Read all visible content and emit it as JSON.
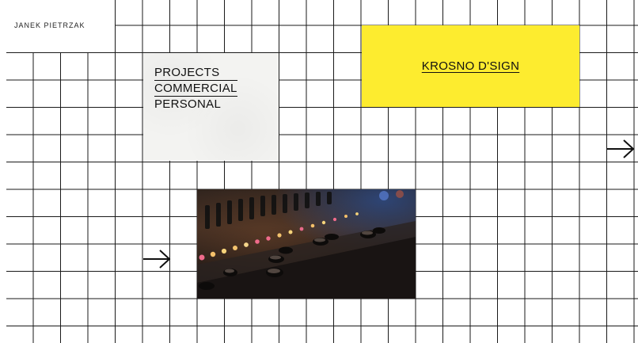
{
  "brand": {
    "name": "JANEK PIETRZAK"
  },
  "nav": {
    "items": [
      {
        "label": "PROJECTS",
        "active": false
      },
      {
        "label": "COMMERCIAL",
        "active": true
      },
      {
        "label": "PERSONAL",
        "active": false
      }
    ]
  },
  "feature": {
    "link_label": "KROSNO D'SIGN",
    "background_color": "#fdec2f"
  },
  "photo": {
    "subject": "audio mixing console faders"
  },
  "arrows": {
    "next": "arrow-right-icon",
    "prev": "arrow-right-icon"
  },
  "colors": {
    "grid_line": "#1a1a1a",
    "background": "#ffffff",
    "accent_yellow": "#fdec2f",
    "card_paper": "#f3f3f1"
  }
}
